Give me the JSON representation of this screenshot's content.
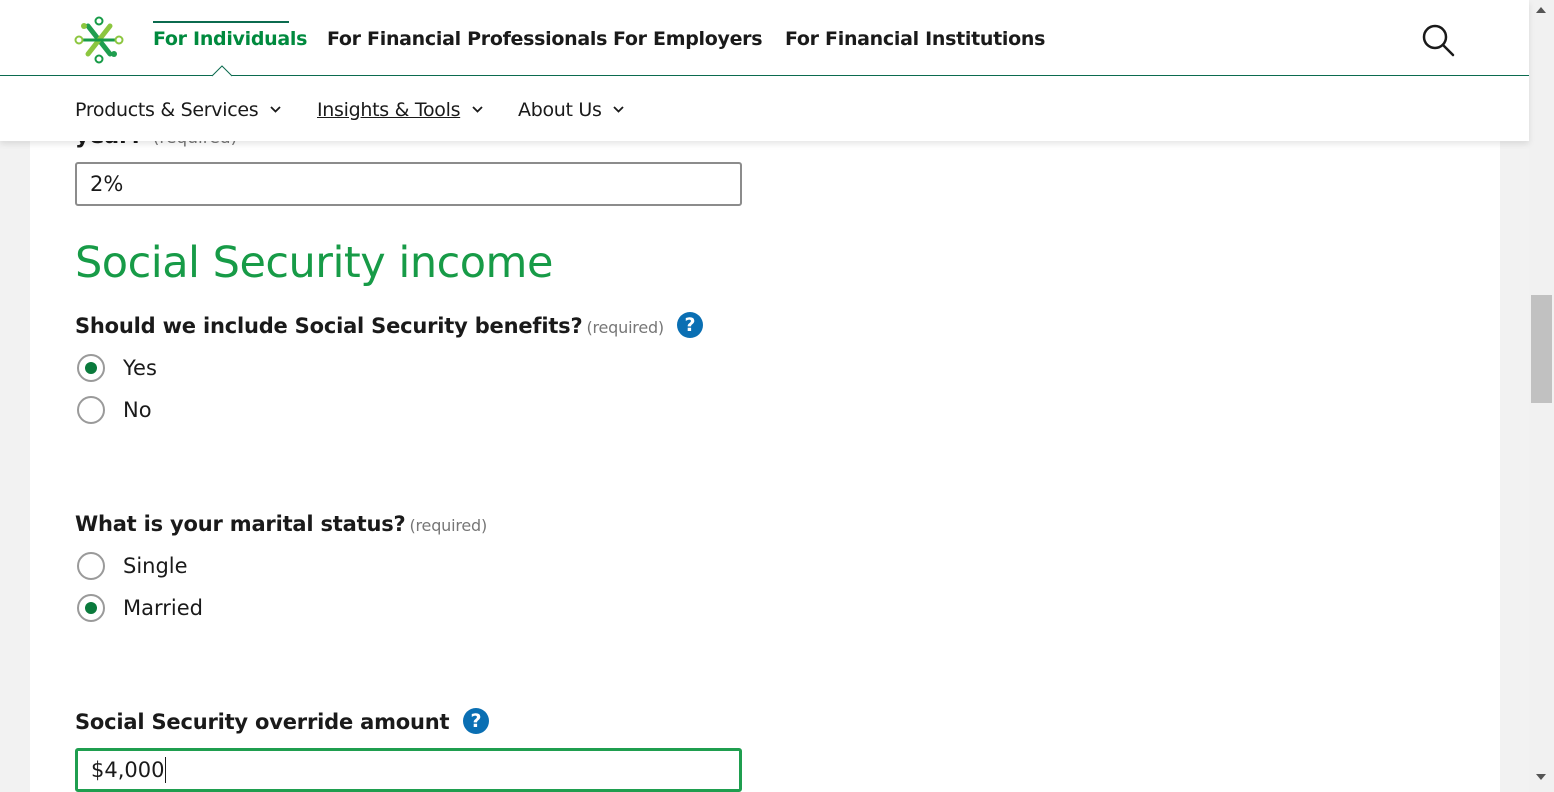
{
  "header": {
    "top_nav": [
      {
        "label": "For Individuals",
        "active": true
      },
      {
        "label": "For Financial Professionals",
        "active": false
      },
      {
        "label": "For Employers",
        "active": false
      },
      {
        "label": "For Financial Institutions",
        "active": false
      }
    ],
    "sub_nav": [
      {
        "label": "Products & Services"
      },
      {
        "label": "Insights & Tools"
      },
      {
        "label": "About Us"
      }
    ],
    "search_icon": "search-icon"
  },
  "form": {
    "partial_label": "year?",
    "partial_required": "(required)",
    "inflation_value": "2%",
    "section_title": "Social Security income",
    "include_ss": {
      "question": "Should we include Social Security benefits?",
      "required": "(required)",
      "options": [
        {
          "label": "Yes",
          "checked": true
        },
        {
          "label": "No",
          "checked": false
        }
      ]
    },
    "marital_status": {
      "question": "What is your marital status?",
      "required": "(required)",
      "options": [
        {
          "label": "Single",
          "checked": false
        },
        {
          "label": "Married",
          "checked": true
        }
      ]
    },
    "override": {
      "label": "Social Security override amount",
      "value": "$4,000"
    },
    "help_glyph": "?"
  },
  "colors": {
    "brand_green": "#179b47",
    "active_nav": "#008a3e",
    "help_blue": "#0a6fb3",
    "radio_checked": "#0a7a3c"
  }
}
